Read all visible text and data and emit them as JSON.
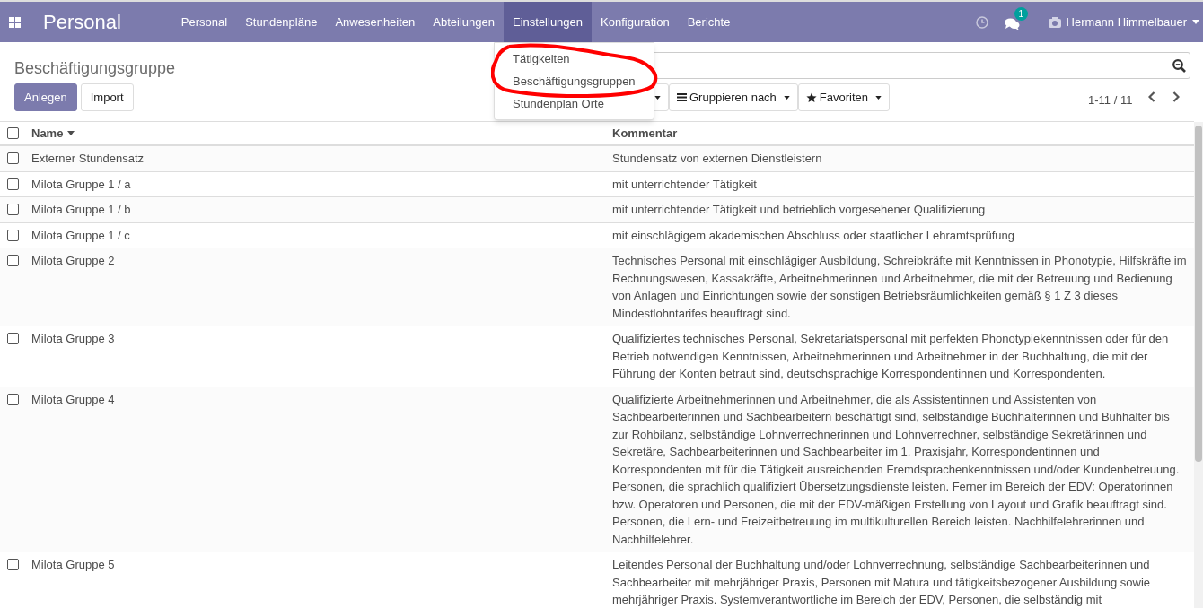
{
  "navbar": {
    "app_title": "Personal",
    "menu": [
      {
        "label": "Personal",
        "selected": false
      },
      {
        "label": "Stundenpläne",
        "selected": false
      },
      {
        "label": "Anwesenheiten",
        "selected": false
      },
      {
        "label": "Abteilungen",
        "selected": false
      },
      {
        "label": "Einstellungen",
        "selected": true
      },
      {
        "label": "Konfiguration",
        "selected": false
      },
      {
        "label": "Berichte",
        "selected": false
      }
    ],
    "message_count": "1",
    "user": "Hermann Himmelbauer"
  },
  "dropdown": {
    "items": [
      "Tätigkeiten",
      "Beschäftigungsgruppen",
      "Stundenplan Orte"
    ]
  },
  "control_panel": {
    "breadcrumb": "Beschäftigungsgruppe",
    "buttons": [
      {
        "label": "Anlegen",
        "kind": "primary"
      },
      {
        "label": "Import",
        "kind": "secondary"
      }
    ],
    "filters": [
      "Gruppieren nach",
      "Favoriten"
    ],
    "pager": "1-11 / 11"
  },
  "table": {
    "all_checked": false,
    "columns": [
      "Name",
      "Kommentar"
    ],
    "rows": [
      {
        "name": "Externer Stundensatz",
        "comment": "Stundensatz von externen Dienstleistern",
        "checked": false
      },
      {
        "name": "Milota Gruppe 1 / a",
        "comment": "mit unterrichtender Tätigkeit",
        "checked": false
      },
      {
        "name": "Milota Gruppe 1 / b",
        "comment": "mit unterrichtender Tätigkeit und betrieblich vorgesehener Qualifizierung",
        "checked": false
      },
      {
        "name": "Milota Gruppe 1 / c",
        "comment": "mit einschlägigem akademischen Abschluss oder staatlicher Lehramtsprüfung",
        "checked": false
      },
      {
        "name": "Milota Gruppe 2",
        "comment": "Technisches Personal mit einschlägiger Ausbildung, Schreibkräfte mit Kenntnissen in Phonotypie, Hilfskräfte im Rechnungswesen, Kassakräfte, Arbeitnehmerinnen und Arbeitnehmer, die mit der Betreuung und Bedienung von Anlagen und Einrichtungen sowie der sonstigen Betriebsräumlichkeiten gemäß § 1 Z 3 dieses Mindestlohntarifes beauftragt sind.",
        "checked": false
      },
      {
        "name": "Milota Gruppe 3",
        "comment": "Qualifiziertes technisches Personal, Sekretariatspersonal mit perfekten Phonotypiekenntnissen oder für den Betrieb notwendigen Kenntnissen, Arbeitnehmerinnen und Arbeitnehmer in der Buchhaltung, die mit der Führung der Konten betraut sind, deutschsprachige Korrespondentinnen und Korrespondenten.",
        "checked": false
      },
      {
        "name": "Milota Gruppe 4",
        "comment": "Qualifizierte Arbeitnehmerinnen und Arbeitnehmer, die als Assistentinnen und Assistenten von\nSachbearbeiterinnen und Sachbearbeitern beschäftigt sind, selbständige Buchhalterinnen und Buhhalter bis\nzur Rohbilanz, selbständige Lohnverrechnerinnen und Lohnverrechner, selbständige Sekretärinnen und\nSekretäre, Sachbearbeiterinnen und Sachbearbeiter im 1. Praxisjahr, Korrespondentinnen und\nKorrespondenten mit für die Tätigkeit ausreichenden Fremdsprachenkenntnissen und/oder Kundenbetreuung.\nPersonen, die sprachlich qualifiziert Übersetzungsdienste leisten. Ferner im Bereich der EDV: Operatorinnen\nbzw. Operatoren und Personen, die mit der EDV-mäßigen Erstellung von Layout und Grafik beauftragt sind.\nPersonen, die Lern- und Freizeitbetreuung im multikulturellen Bereich leisten. Nachhilfelehrerinnen und\nNachhilfelehrer.",
        "checked": false
      },
      {
        "name": "Milota Gruppe 5",
        "comment": "Leitendes Personal der Buchhaltung und/oder Lohnverrechnung, selbständige Sachbearbeiterinnen und Sachbearbeiter mit mehrjähriger Praxis, Personen mit Matura und tätigkeitsbezogener Ausbildung sowie mehrjähriger Praxis. Systemverantwortliche im Bereich der EDV, Personen, die selbständig mit",
        "checked": false
      }
    ]
  }
}
